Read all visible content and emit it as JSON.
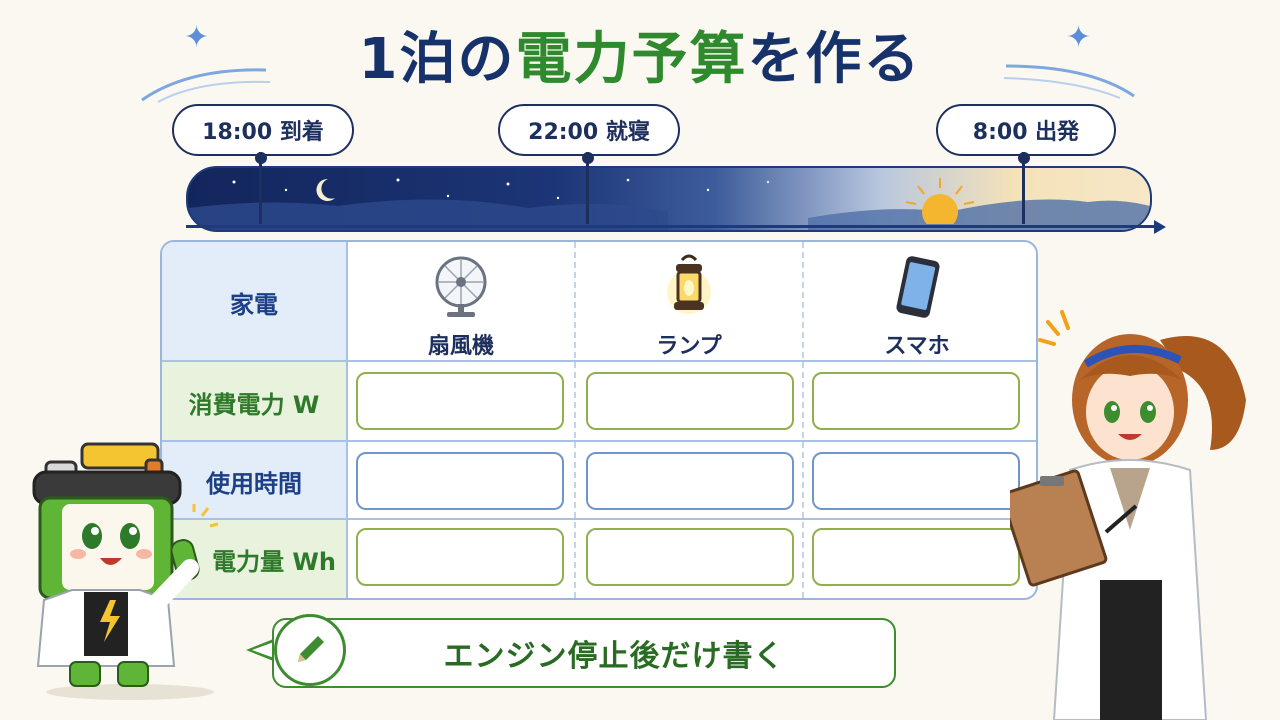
{
  "title": {
    "pre": "1泊の",
    "highlight": "電力予算",
    "post": "を作る"
  },
  "timeline": [
    {
      "time": "18:00 到着"
    },
    {
      "time": "22:00 就寝"
    },
    {
      "time": "8:00 出発"
    }
  ],
  "table": {
    "header_label": "家電",
    "columns": [
      {
        "label": "扇風機",
        "icon": "fan-icon"
      },
      {
        "label": "ランプ",
        "icon": "lantern-icon"
      },
      {
        "label": "スマホ",
        "icon": "smartphone-icon"
      }
    ],
    "rows": [
      {
        "label": "消費電力 W",
        "color": "#2f7a2a"
      },
      {
        "label": "使用時間",
        "color": "#1d3f86"
      },
      {
        "label": "電力量 Wh",
        "color": "#2f7a2a"
      }
    ]
  },
  "note": {
    "text": "エンジン停止後だけ書く",
    "icon": "pencil-icon"
  },
  "colors": {
    "navy": "#17326b",
    "green": "#2f8a2d"
  }
}
